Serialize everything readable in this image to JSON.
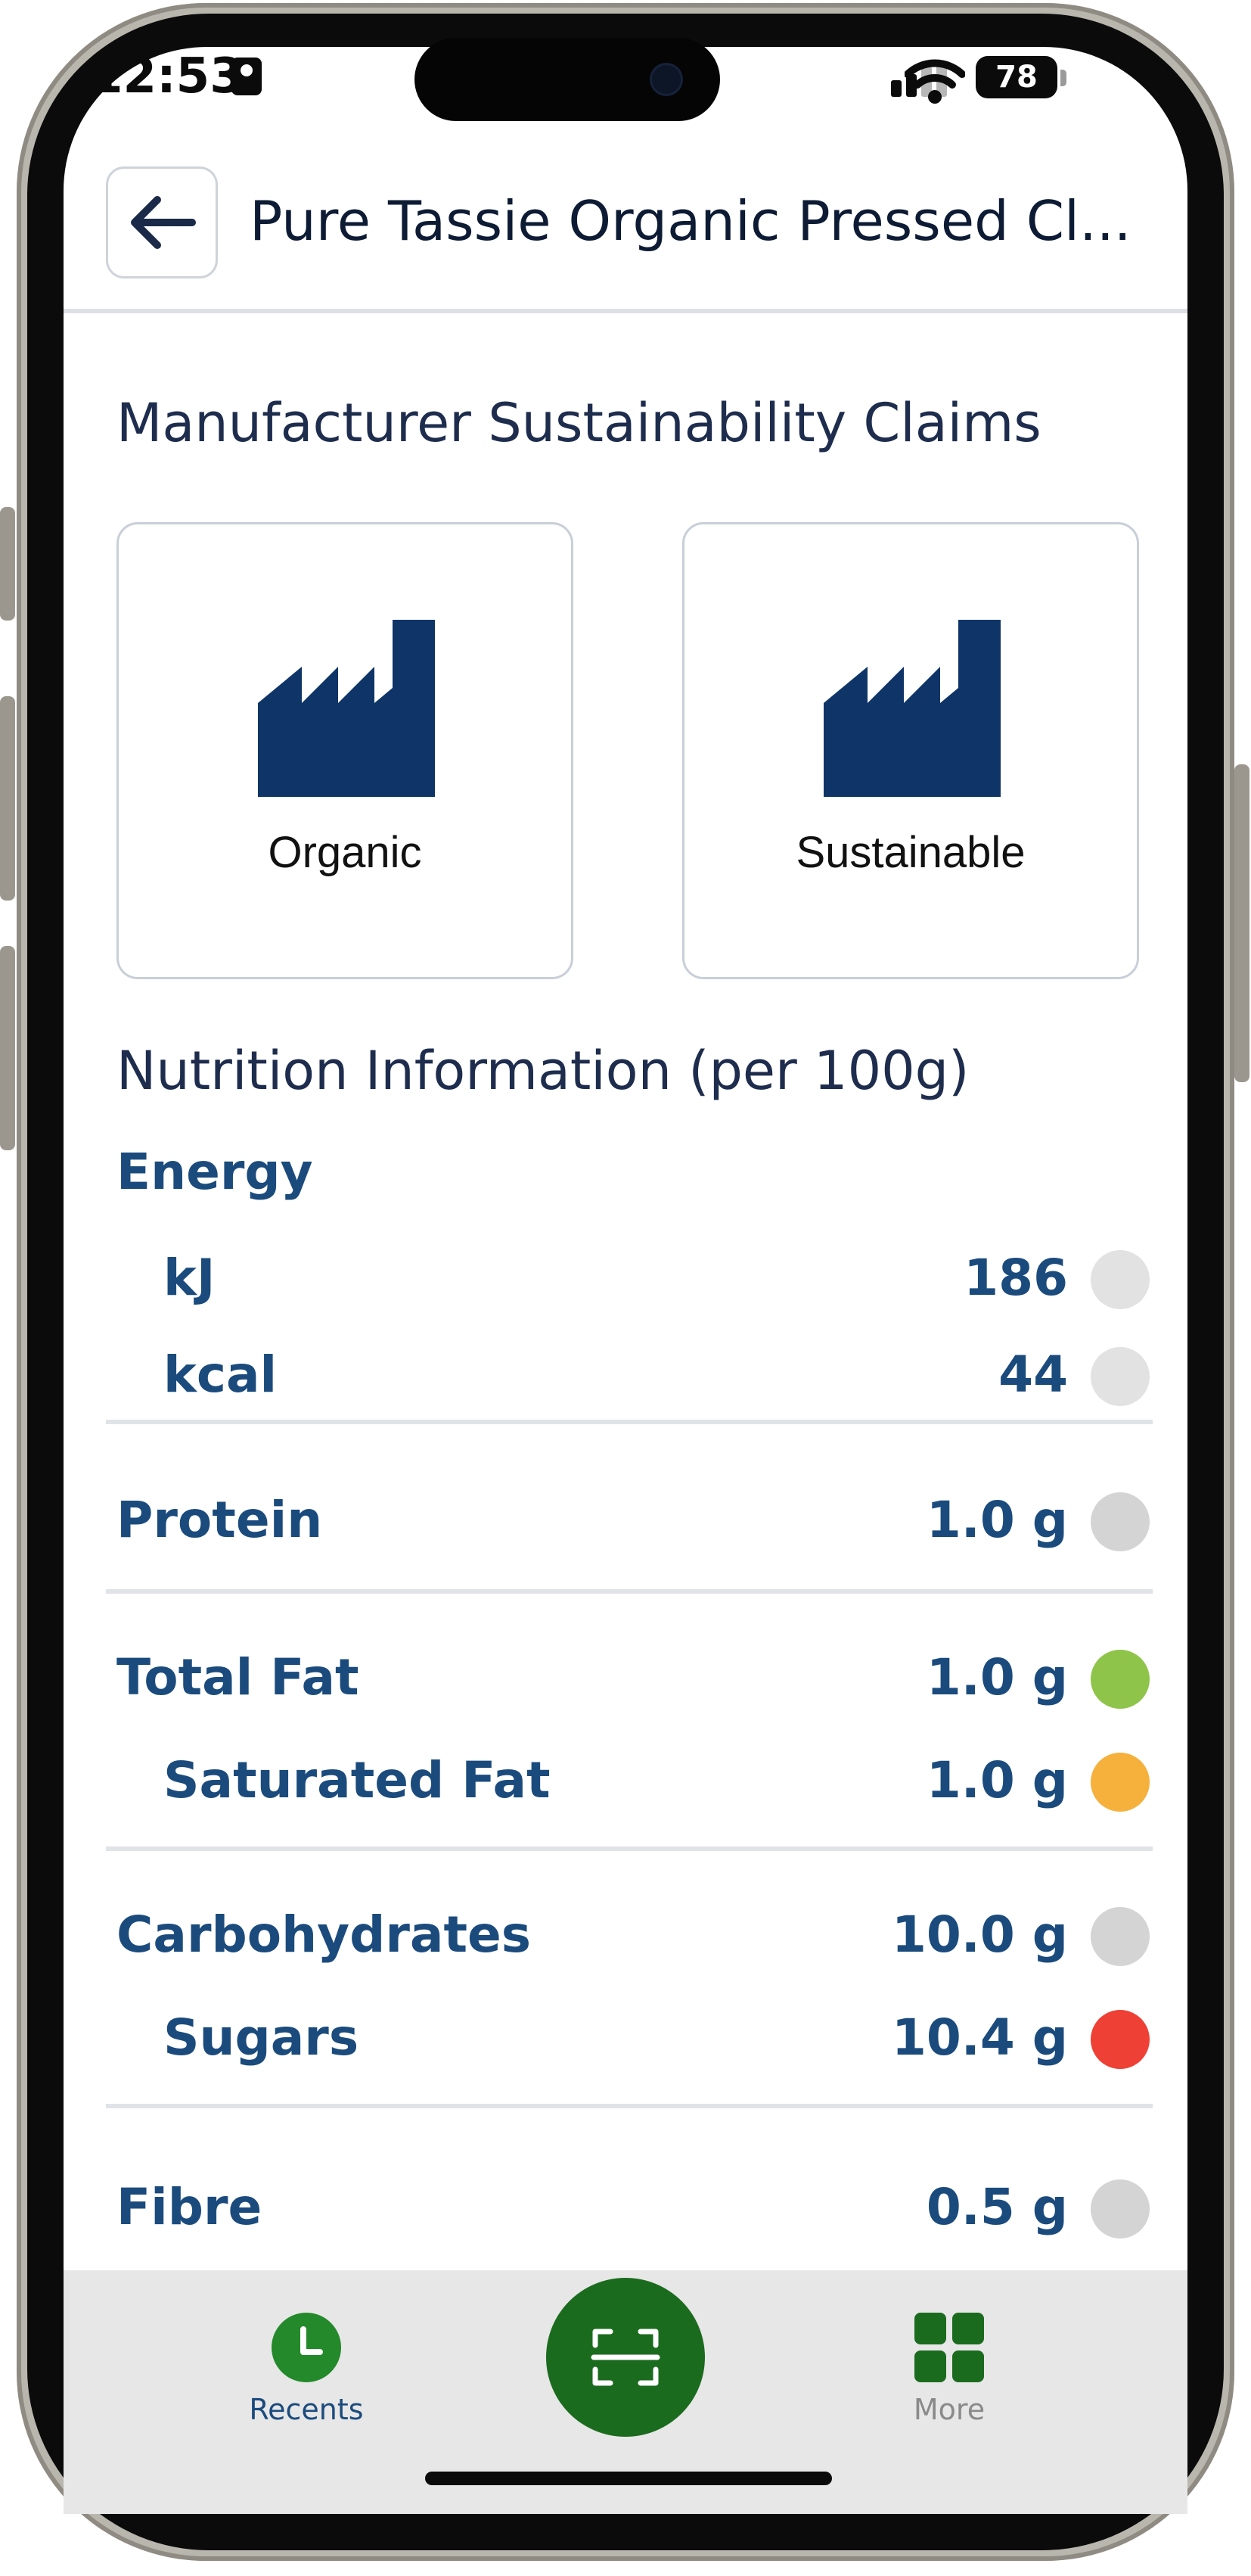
{
  "status_bar": {
    "time": "12:53",
    "battery": "78"
  },
  "header": {
    "title": "Pure Tassie Organic Pressed Cl..."
  },
  "claims": {
    "title": "Manufacturer Sustainability Claims",
    "items": [
      {
        "label": "Organic",
        "icon": "factory-icon"
      },
      {
        "label": "Sustainable",
        "icon": "factory-icon"
      }
    ]
  },
  "nutrition": {
    "title": "Nutrition Information (per 100g)",
    "energy_label": "Energy",
    "rows": [
      {
        "label": "kJ",
        "value": "186",
        "status_color": "#e2e2e2"
      },
      {
        "label": "kcal",
        "value": "44",
        "status_color": "#e2e2e2"
      },
      {
        "label": "Protein",
        "value": "1.0 g",
        "status_color": "#d4d4d4"
      },
      {
        "label": "Total Fat",
        "value": "1.0 g",
        "status_color": "#8fc44a"
      },
      {
        "label": "Saturated Fat",
        "value": "1.0 g",
        "status_color": "#f6b13c"
      },
      {
        "label": "Carbohydrates",
        "value": "10.0 g",
        "status_color": "#d4d4d4"
      },
      {
        "label": "Sugars",
        "value": "10.4 g",
        "status_color": "#ee4035"
      },
      {
        "label": "Fibre",
        "value": "0.5 g",
        "status_color": "#d4d4d4"
      }
    ]
  },
  "bottom_nav": {
    "recents_label": "Recents",
    "more_label": "More"
  },
  "colors": {
    "accent_green": "#1b6b1e",
    "nav_green": "#23892a",
    "text_blue": "#1b4b7d",
    "icon_navy": "#0f3568"
  }
}
